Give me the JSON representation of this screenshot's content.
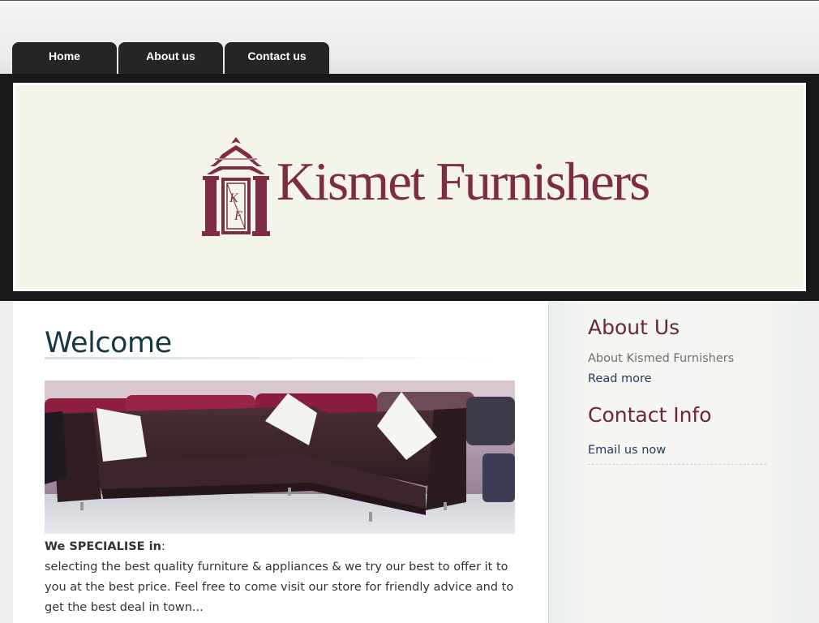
{
  "nav": {
    "tabs": [
      {
        "label": "Home"
      },
      {
        "label": "About us"
      },
      {
        "label": "Contact us"
      }
    ]
  },
  "banner": {
    "brand_name": "Kismet Furnishers",
    "emblem_letters": "KF"
  },
  "main": {
    "heading": "Welcome",
    "photo_alt": "sofa-photo",
    "specialise_label": "We SPECIALISE in",
    "specialise_colon": ":",
    "lines": [
      "selecting the best quality furniture & appliances & we try our best to offer it to",
      "you at the best price. Feel free to come visit our store for friendly advice and to",
      "get the best deal in town..."
    ]
  },
  "sidebar": {
    "about_heading": "About Us",
    "about_text": "About Kismed Furnishers",
    "read_more": "Read more",
    "contact_heading": "Contact Info",
    "email_link": "Email us now"
  },
  "colors": {
    "brand": "#7d2c43",
    "heading": "#143843",
    "side_heading": "#6b2638",
    "link": "#1f3a5e",
    "tab_bg": "#252525"
  }
}
